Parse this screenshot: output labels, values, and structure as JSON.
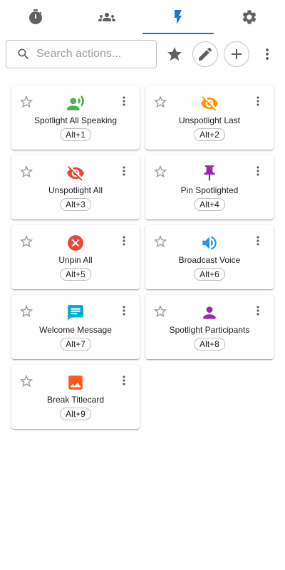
{
  "search": {
    "placeholder": "Search actions..."
  },
  "actions": [
    {
      "label": "Spotlight All Speaking",
      "shortcut": "Alt+1",
      "icon": "record-voice-icon",
      "color": "#4caf50"
    },
    {
      "label": "Unspotlight Last",
      "shortcut": "Alt+2",
      "icon": "visibility-off-icon",
      "color": "#ff9800"
    },
    {
      "label": "Unspotlight All",
      "shortcut": "Alt+3",
      "icon": "visibility-off-icon",
      "color": "#f44336"
    },
    {
      "label": "Pin Spotlighted",
      "shortcut": "Alt+4",
      "icon": "push-pin-icon",
      "color": "#9c27b0"
    },
    {
      "label": "Unpin All",
      "shortcut": "Alt+5",
      "icon": "cancel-icon",
      "color": "#f44336"
    },
    {
      "label": "Broadcast Voice",
      "shortcut": "Alt+6",
      "icon": "volume-up-icon",
      "color": "#2196f3"
    },
    {
      "label": "Welcome Message",
      "shortcut": "Alt+7",
      "icon": "chat-icon",
      "color": "#00acc1"
    },
    {
      "label": "Spotlight Participants",
      "shortcut": "Alt+8",
      "icon": "person-icon",
      "color": "#9c27b0"
    },
    {
      "label": "Break Titlecard",
      "shortcut": "Alt+9",
      "icon": "image-icon",
      "color": "#ff5722"
    }
  ],
  "colors": {
    "accent": "#1976d2"
  }
}
